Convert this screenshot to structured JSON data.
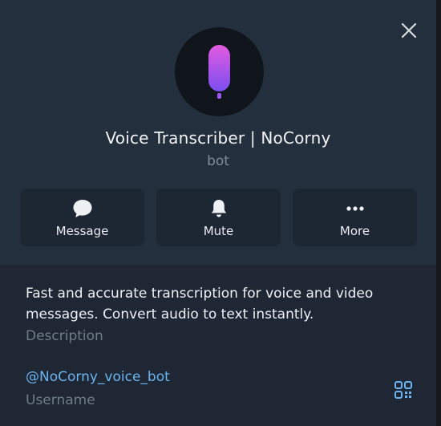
{
  "profile": {
    "name": "Voice Transcriber | NoCorny",
    "type": "bot"
  },
  "actions": [
    {
      "label": "Message",
      "icon": "message-bubble-icon"
    },
    {
      "label": "Mute",
      "icon": "bell-icon"
    },
    {
      "label": "More",
      "icon": "more-dots-icon"
    }
  ],
  "info": {
    "description": "Fast and accurate transcription for voice and video messages. Convert audio to text instantly.",
    "description_label": "Description",
    "username": "@NoCorny_voice_bot",
    "username_label": "Username"
  },
  "colors": {
    "accent": "#6cb4f0",
    "mic_gradient_top": "#e25be0",
    "mic_gradient_bottom": "#7a4ef0"
  }
}
